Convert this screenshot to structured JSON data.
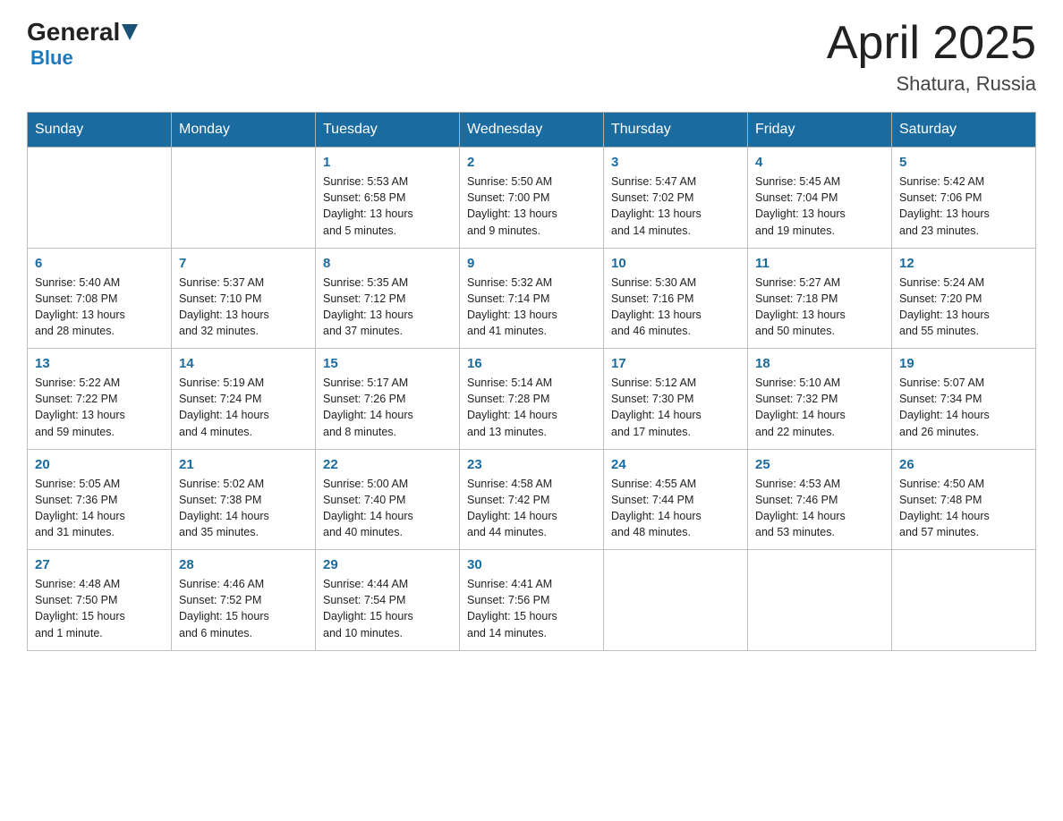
{
  "header": {
    "logo_general": "General",
    "logo_blue": "Blue",
    "month_title": "April 2025",
    "location": "Shatura, Russia"
  },
  "weekdays": [
    "Sunday",
    "Monday",
    "Tuesday",
    "Wednesday",
    "Thursday",
    "Friday",
    "Saturday"
  ],
  "weeks": [
    [
      {
        "day": "",
        "info": ""
      },
      {
        "day": "",
        "info": ""
      },
      {
        "day": "1",
        "info": "Sunrise: 5:53 AM\nSunset: 6:58 PM\nDaylight: 13 hours\nand 5 minutes."
      },
      {
        "day": "2",
        "info": "Sunrise: 5:50 AM\nSunset: 7:00 PM\nDaylight: 13 hours\nand 9 minutes."
      },
      {
        "day": "3",
        "info": "Sunrise: 5:47 AM\nSunset: 7:02 PM\nDaylight: 13 hours\nand 14 minutes."
      },
      {
        "day": "4",
        "info": "Sunrise: 5:45 AM\nSunset: 7:04 PM\nDaylight: 13 hours\nand 19 minutes."
      },
      {
        "day": "5",
        "info": "Sunrise: 5:42 AM\nSunset: 7:06 PM\nDaylight: 13 hours\nand 23 minutes."
      }
    ],
    [
      {
        "day": "6",
        "info": "Sunrise: 5:40 AM\nSunset: 7:08 PM\nDaylight: 13 hours\nand 28 minutes."
      },
      {
        "day": "7",
        "info": "Sunrise: 5:37 AM\nSunset: 7:10 PM\nDaylight: 13 hours\nand 32 minutes."
      },
      {
        "day": "8",
        "info": "Sunrise: 5:35 AM\nSunset: 7:12 PM\nDaylight: 13 hours\nand 37 minutes."
      },
      {
        "day": "9",
        "info": "Sunrise: 5:32 AM\nSunset: 7:14 PM\nDaylight: 13 hours\nand 41 minutes."
      },
      {
        "day": "10",
        "info": "Sunrise: 5:30 AM\nSunset: 7:16 PM\nDaylight: 13 hours\nand 46 minutes."
      },
      {
        "day": "11",
        "info": "Sunrise: 5:27 AM\nSunset: 7:18 PM\nDaylight: 13 hours\nand 50 minutes."
      },
      {
        "day": "12",
        "info": "Sunrise: 5:24 AM\nSunset: 7:20 PM\nDaylight: 13 hours\nand 55 minutes."
      }
    ],
    [
      {
        "day": "13",
        "info": "Sunrise: 5:22 AM\nSunset: 7:22 PM\nDaylight: 13 hours\nand 59 minutes."
      },
      {
        "day": "14",
        "info": "Sunrise: 5:19 AM\nSunset: 7:24 PM\nDaylight: 14 hours\nand 4 minutes."
      },
      {
        "day": "15",
        "info": "Sunrise: 5:17 AM\nSunset: 7:26 PM\nDaylight: 14 hours\nand 8 minutes."
      },
      {
        "day": "16",
        "info": "Sunrise: 5:14 AM\nSunset: 7:28 PM\nDaylight: 14 hours\nand 13 minutes."
      },
      {
        "day": "17",
        "info": "Sunrise: 5:12 AM\nSunset: 7:30 PM\nDaylight: 14 hours\nand 17 minutes."
      },
      {
        "day": "18",
        "info": "Sunrise: 5:10 AM\nSunset: 7:32 PM\nDaylight: 14 hours\nand 22 minutes."
      },
      {
        "day": "19",
        "info": "Sunrise: 5:07 AM\nSunset: 7:34 PM\nDaylight: 14 hours\nand 26 minutes."
      }
    ],
    [
      {
        "day": "20",
        "info": "Sunrise: 5:05 AM\nSunset: 7:36 PM\nDaylight: 14 hours\nand 31 minutes."
      },
      {
        "day": "21",
        "info": "Sunrise: 5:02 AM\nSunset: 7:38 PM\nDaylight: 14 hours\nand 35 minutes."
      },
      {
        "day": "22",
        "info": "Sunrise: 5:00 AM\nSunset: 7:40 PM\nDaylight: 14 hours\nand 40 minutes."
      },
      {
        "day": "23",
        "info": "Sunrise: 4:58 AM\nSunset: 7:42 PM\nDaylight: 14 hours\nand 44 minutes."
      },
      {
        "day": "24",
        "info": "Sunrise: 4:55 AM\nSunset: 7:44 PM\nDaylight: 14 hours\nand 48 minutes."
      },
      {
        "day": "25",
        "info": "Sunrise: 4:53 AM\nSunset: 7:46 PM\nDaylight: 14 hours\nand 53 minutes."
      },
      {
        "day": "26",
        "info": "Sunrise: 4:50 AM\nSunset: 7:48 PM\nDaylight: 14 hours\nand 57 minutes."
      }
    ],
    [
      {
        "day": "27",
        "info": "Sunrise: 4:48 AM\nSunset: 7:50 PM\nDaylight: 15 hours\nand 1 minute."
      },
      {
        "day": "28",
        "info": "Sunrise: 4:46 AM\nSunset: 7:52 PM\nDaylight: 15 hours\nand 6 minutes."
      },
      {
        "day": "29",
        "info": "Sunrise: 4:44 AM\nSunset: 7:54 PM\nDaylight: 15 hours\nand 10 minutes."
      },
      {
        "day": "30",
        "info": "Sunrise: 4:41 AM\nSunset: 7:56 PM\nDaylight: 15 hours\nand 14 minutes."
      },
      {
        "day": "",
        "info": ""
      },
      {
        "day": "",
        "info": ""
      },
      {
        "day": "",
        "info": ""
      }
    ]
  ]
}
